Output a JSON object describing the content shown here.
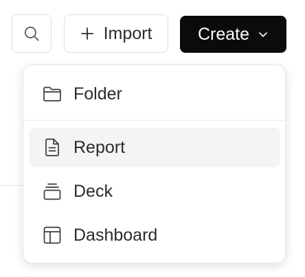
{
  "toolbar": {
    "search_icon": "search-icon",
    "import_label": "Import",
    "import_icon": "plus-icon",
    "create_label": "Create",
    "create_icon": "chevron-down-icon"
  },
  "menu": {
    "items": [
      {
        "label": "Folder",
        "icon": "folder-icon"
      },
      {
        "label": "Report",
        "icon": "document-icon",
        "highlighted": true
      },
      {
        "label": "Deck",
        "icon": "deck-icon"
      },
      {
        "label": "Dashboard",
        "icon": "dashboard-icon"
      }
    ]
  },
  "colors": {
    "primary_button_bg": "#0b0b0b",
    "primary_button_text": "#ffffff",
    "hover_bg": "#f4f4f4",
    "border": "#dedede",
    "text": "#2b2b2b"
  }
}
